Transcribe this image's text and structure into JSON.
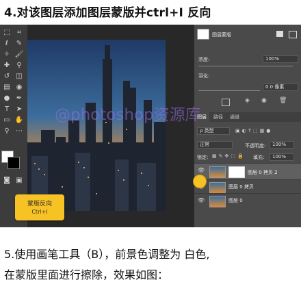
{
  "step4_title": "4.对该图层添加图层蒙版并ctrl+I 反向",
  "watermark": "@photoshop资源库",
  "callout": {
    "line1": "蒙版反向",
    "line2": "Ctrl+I"
  },
  "properties": {
    "title": "图层蒙版",
    "density_label": "浓度:",
    "density_value": "100%",
    "feather_label": "羽化:",
    "feather_value": "0.0 像素"
  },
  "layers_panel": {
    "tabs": [
      "图层",
      "路径",
      "通道"
    ],
    "filter_label": "ρ 类型",
    "blend_mode": "正常",
    "opacity_label": "不透明度:",
    "opacity_value": "100%",
    "lock_label": "锁定:",
    "fill_label": "填充:",
    "fill_value": "100%",
    "layers": [
      {
        "name": "图层 0 拷贝 2"
      },
      {
        "name": "图层 0 拷贝"
      },
      {
        "name": "图层 0"
      }
    ]
  },
  "step5_line1": "5.使用画笔工具（B），前景色调整为 白色,",
  "step5_line2": "在蒙版里面进行擦除，效果如图：",
  "colors": {
    "callout": "#f7c224",
    "ps_dark": "#3a3a3a",
    "watermark": "#9670dc"
  }
}
